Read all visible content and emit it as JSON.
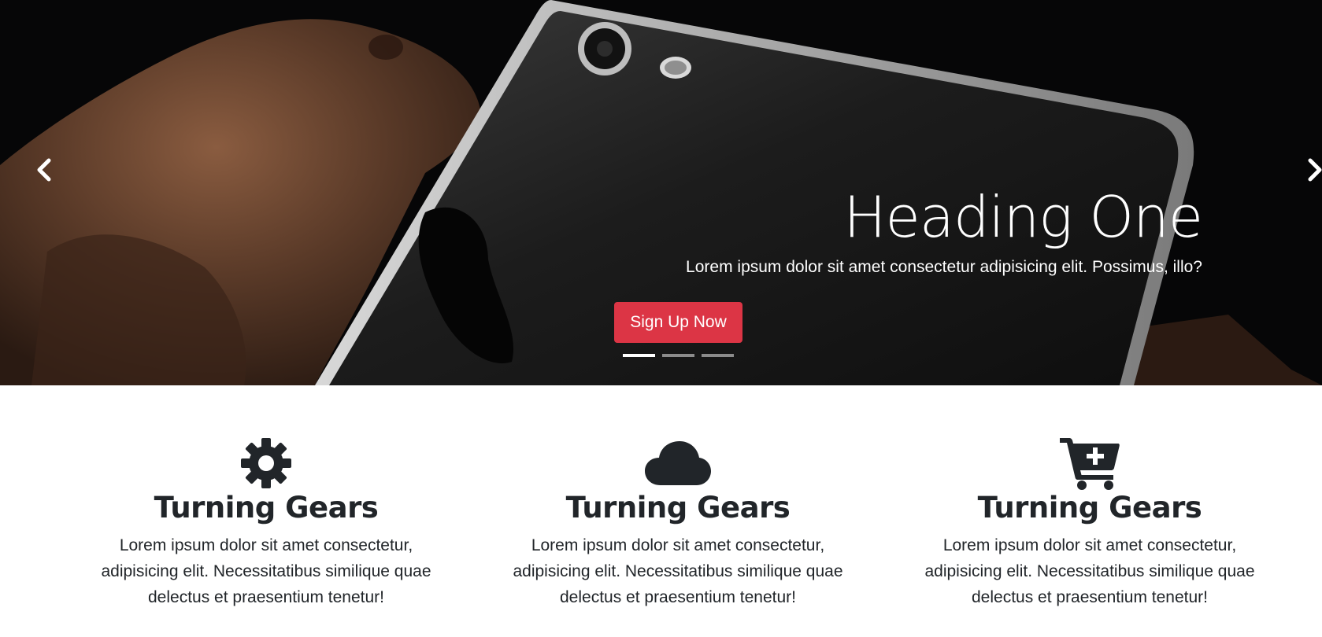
{
  "carousel": {
    "heading": "Heading One",
    "text": "Lorem ipsum dolor sit amet consectetur adipisicing elit. Possimus, illo?",
    "button_label": "Sign Up Now",
    "prev_icon": "chevron-left-icon",
    "next_icon": "chevron-right-icon",
    "slide_count": 3,
    "active_slide": 1,
    "button_color": "#dc3545"
  },
  "features": [
    {
      "icon": "gear-icon",
      "title": "Turning Gears",
      "text": "Lorem ipsum dolor sit amet consectetur, adipisicing elit. Necessitatibus similique quae delectus et praesentium tenetur!"
    },
    {
      "icon": "cloud-icon",
      "title": "Turning Gears",
      "text": "Lorem ipsum dolor sit amet consectetur, adipisicing elit. Necessitatibus similique quae delectus et praesentium tenetur!"
    },
    {
      "icon": "cart-plus-icon",
      "title": "Turning Gears",
      "text": "Lorem ipsum dolor sit amet consectetur, adipisicing elit. Necessitatibus similique quae delectus et praesentium tenetur!"
    }
  ]
}
